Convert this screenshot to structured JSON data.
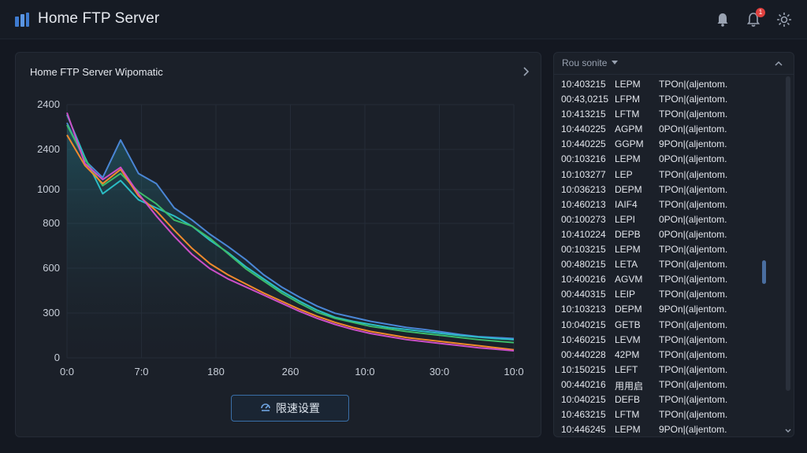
{
  "app": {
    "title": "Home FTP Server",
    "notification_count": "1"
  },
  "chart_panel": {
    "title": "Home FTP Server Wipomatic",
    "button_label": "限速设置"
  },
  "chart_data": {
    "type": "line",
    "title": "Home FTP Server Wipomatic",
    "x_tick_labels": [
      "0:0",
      "7:0",
      "180",
      "260",
      "10:0",
      "30:0",
      "10:0"
    ],
    "y_tick_labels": [
      "2400",
      "2400",
      "1000",
      "800",
      "600",
      "300",
      "0"
    ],
    "x_positions": [
      0,
      16.67,
      33.33,
      50,
      66.67,
      83.33,
      100
    ],
    "y_positions": [
      0,
      300,
      600,
      800,
      1000,
      2400,
      2400
    ],
    "series": [
      {
        "color": "#4a86d6",
        "x": [
          0,
          4,
          8,
          12,
          16,
          20,
          24,
          28,
          32,
          36,
          40,
          44,
          48,
          52,
          56,
          60,
          64,
          68,
          72,
          76,
          80,
          84,
          88,
          92,
          96,
          100
        ],
        "y": [
          2320,
          1950,
          1780,
          2150,
          1820,
          1720,
          1480,
          1360,
          1220,
          1100,
          970,
          820,
          700,
          600,
          510,
          440,
          400,
          360,
          330,
          300,
          280,
          255,
          230,
          210,
          200,
          190
        ]
      },
      {
        "color": "#2bbcc4",
        "x": [
          0,
          4,
          8,
          12,
          16,
          20,
          24,
          28,
          32,
          36,
          40,
          44,
          48,
          52,
          56,
          60,
          64,
          68,
          72,
          76,
          80,
          84,
          88,
          92,
          96,
          100
        ],
        "y": [
          2400,
          1980,
          1620,
          1750,
          1560,
          1480,
          1400,
          1300,
          1160,
          1040,
          900,
          780,
          660,
          560,
          470,
          400,
          360,
          330,
          300,
          280,
          260,
          240,
          220,
          205,
          190,
          180
        ]
      },
      {
        "color": "#3dbb6a",
        "x": [
          0,
          4,
          8,
          12,
          16,
          20,
          24,
          28,
          32,
          36,
          40,
          44,
          48,
          52,
          56,
          60,
          64,
          68,
          72,
          76,
          80,
          84,
          88,
          92,
          96,
          100
        ],
        "y": [
          2300,
          1960,
          1700,
          1820,
          1640,
          1520,
          1360,
          1300,
          1180,
          1030,
          880,
          760,
          640,
          540,
          450,
          390,
          350,
          310,
          285,
          260,
          240,
          220,
          200,
          180,
          165,
          150
        ]
      },
      {
        "color": "#f08a2c",
        "x": [
          0,
          4,
          8,
          12,
          16,
          20,
          24,
          28,
          32,
          36,
          40,
          44,
          48,
          52,
          56,
          60,
          64,
          68,
          72,
          76,
          80,
          84,
          88,
          92,
          96,
          100
        ],
        "y": [
          2200,
          1900,
          1720,
          1860,
          1600,
          1450,
          1260,
          1080,
          930,
          820,
          730,
          640,
          560,
          480,
          410,
          350,
          300,
          260,
          230,
          200,
          180,
          160,
          140,
          120,
          100,
          80
        ]
      },
      {
        "color": "#cc4fc8",
        "x": [
          0,
          4,
          8,
          12,
          16,
          20,
          24,
          28,
          32,
          36,
          40,
          44,
          48,
          52,
          56,
          60,
          64,
          68,
          72,
          76,
          80,
          84,
          88,
          92,
          96,
          100
        ],
        "y": [
          2420,
          1920,
          1760,
          1880,
          1620,
          1400,
          1200,
          1020,
          880,
          780,
          700,
          620,
          540,
          460,
          390,
          330,
          280,
          240,
          210,
          180,
          160,
          140,
          120,
          100,
          85,
          70
        ]
      }
    ]
  },
  "log_panel": {
    "select_label": "Rou sonite",
    "rows": [
      {
        "time": "10:403215",
        "type": "LEPM",
        "msg": "TPOn|(aljentom."
      },
      {
        "time": "00:43,0215",
        "type": "LFPM",
        "msg": "TPOn|(aljentom."
      },
      {
        "time": "10:413215",
        "type": "LFTM",
        "msg": "TPOn|(aljentom."
      },
      {
        "time": "10:440225",
        "type": "AGPM",
        "msg": "0POn|(aljentom."
      },
      {
        "time": "10:440225",
        "type": "GGPM",
        "msg": "9POn|(aljentom."
      },
      {
        "time": "00:103216",
        "type": "LEPM",
        "msg": "0POn|(aljentom."
      },
      {
        "time": "10:103277",
        "type": "LEP",
        "msg": "TPOn|(aljentom."
      },
      {
        "time": "10:036213",
        "type": "DEPM",
        "msg": "TPOn|(aljentom."
      },
      {
        "time": "10:460213",
        "type": "IAIF4",
        "msg": "TPOn|(aljentom."
      },
      {
        "time": "00:100273",
        "type": "LEPI",
        "msg": "0POn|(aljentom."
      },
      {
        "time": "10:410224",
        "type": "DEPB",
        "msg": "0POn|(aljentom."
      },
      {
        "time": "00:103215",
        "type": "LEPM",
        "msg": "TPOn|(aljentom."
      },
      {
        "time": "00:480215",
        "type": "LETA",
        "msg": "TPOn|(aljentom."
      },
      {
        "time": "10:400216",
        "type": "AGVM",
        "msg": "TPOn|(aljentom."
      },
      {
        "time": "00:440315",
        "type": "LEIP",
        "msg": "TPOn|(aljentom."
      },
      {
        "time": "10:103213",
        "type": "DEPM",
        "msg": "9POn|(aljentom."
      },
      {
        "time": "10:040215",
        "type": "GETB",
        "msg": "TPOn|(aljentom."
      },
      {
        "time": "10:460215",
        "type": "LEVM",
        "msg": "TPOn|(aljentom."
      },
      {
        "time": "00:440228",
        "type": "42PM",
        "msg": "TPOn|(aljentom."
      },
      {
        "time": "10:150215",
        "type": "LEFT",
        "msg": "TPOn|(aljentom."
      },
      {
        "time": "00:440216",
        "type": "用用启",
        "msg": "TPOn|(aljentom."
      },
      {
        "time": "10:040215",
        "type": "DEFB",
        "msg": "TPOn|(aljentom."
      },
      {
        "time": "10:463215",
        "type": "LFTM",
        "msg": "TPOn|(aljentom."
      },
      {
        "time": "10:446245",
        "type": "LEPM",
        "msg": "9POn|(aljentom."
      }
    ]
  },
  "colors": {
    "background": "#141821",
    "panel": "#1b2029",
    "accent": "#3a6fa8",
    "badge": "#e0413f"
  },
  "icons": [
    "app-logo-icon",
    "bell-icon",
    "notification-icon",
    "settings-icon",
    "chevron-right-icon",
    "speed-limit-icon",
    "caret-down-icon",
    "chevron-up-icon",
    "chevron-down-icon"
  ]
}
